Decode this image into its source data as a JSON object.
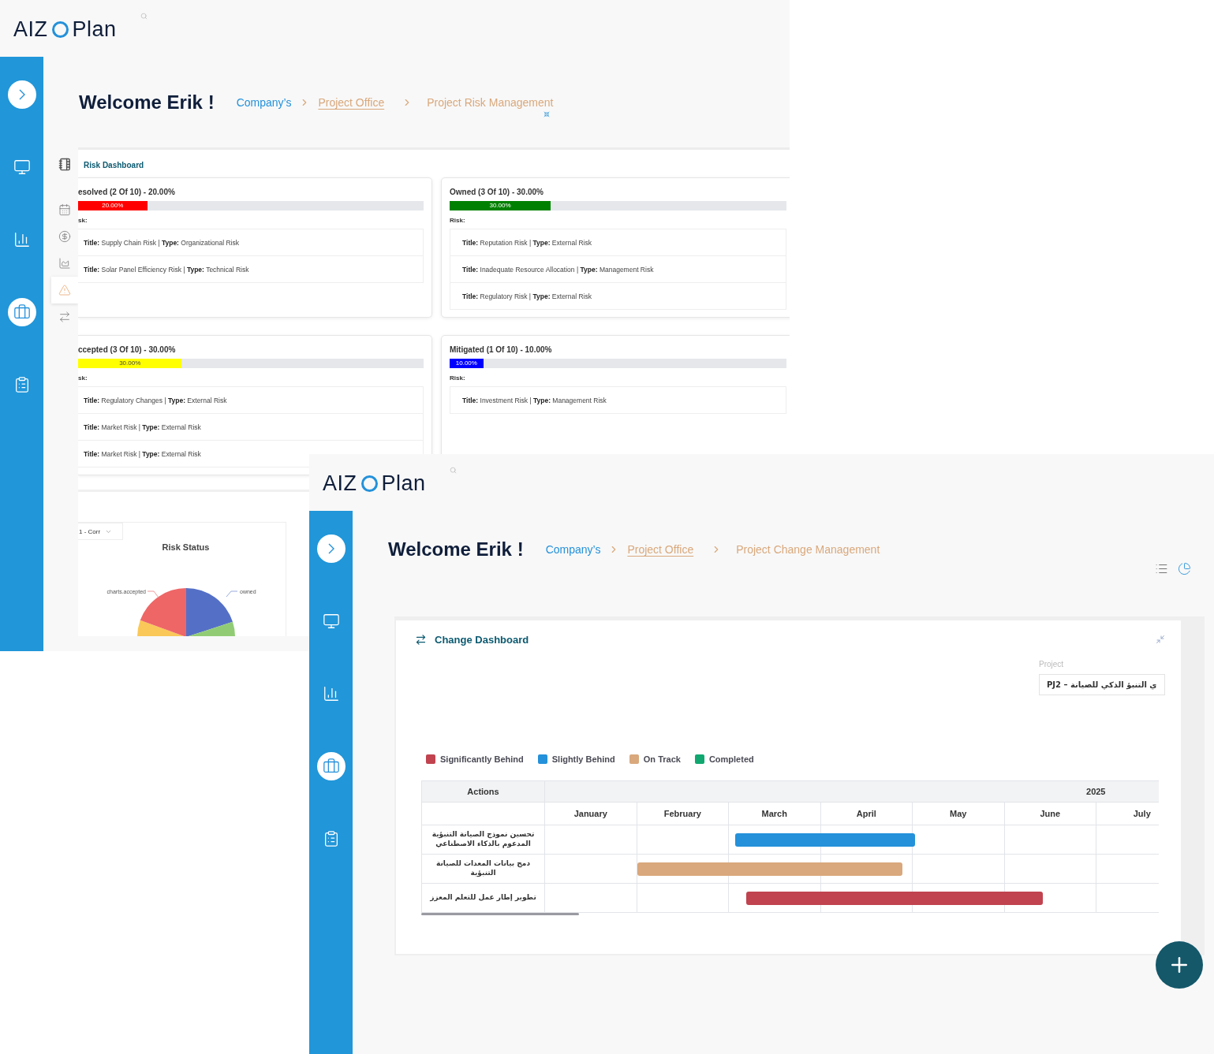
{
  "risk_screen": {
    "logo": {
      "left": "AIZ",
      "right": "Plan"
    },
    "sidebar": [
      {
        "kind": "toggle"
      },
      {
        "kind": "monitor",
        "selected": false
      },
      {
        "kind": "analytics",
        "selected": false
      },
      {
        "kind": "briefcase",
        "selected": true
      },
      {
        "kind": "clipboard",
        "selected": false
      }
    ],
    "welcome": "Welcome Erik !",
    "breadcrumb": [
      {
        "label": "Company’s",
        "kind": "root"
      },
      {
        "label": "Project Office",
        "kind": "link"
      },
      {
        "label": "Project Risk Management",
        "kind": "current"
      }
    ],
    "sub_sidebar": [
      {
        "kind": "calendar",
        "selected": false
      },
      {
        "kind": "finance",
        "selected": false
      },
      {
        "kind": "trend",
        "selected": false
      },
      {
        "kind": "warning",
        "selected": true
      },
      {
        "kind": "swap",
        "selected": false
      }
    ],
    "dashboard_title": "Risk Dashboard",
    "cards": [
      {
        "title": "esolved (2 Of 10) - 20.00%",
        "level": 0.2,
        "bar_label": "20.00%",
        "color": "#ff0000",
        "list_label": "sk:",
        "risks": [
          "**Title:** Supply Chain Risk | **Type:** Organizational Risk",
          "**Title:** Solar Panel Efficiency Risk | **Type:** Technical Risk"
        ]
      },
      {
        "title": "Owned (3 Of 10) - 30.00%",
        "level": 0.3,
        "bar_label": "30.00%",
        "color": "#008000",
        "list_label": "Risk:",
        "risks": [
          "**Title:** Reputation Risk | **Type:** External Risk",
          "**Title:** Inadequate Resource Allocation | **Type:** Management Risk",
          "**Title:** Regulatory Risk | **Type:** External Risk"
        ]
      },
      {
        "title": "ccepted (3 Of 10) - 30.00%",
        "level": 0.3,
        "bar_label": "30.00%",
        "color": "#ffff00",
        "list_label": "sk:",
        "risks": [
          "**Title:** Regulatory Changes | **Type:** External Risk",
          "**Title:** Market Risk | **Type:** External Risk",
          "**Title:** Market Risk | **Type:** External Risk"
        ]
      },
      {
        "title": "Mitigated (1 Of 10) - 10.00%",
        "level": 0.1,
        "bar_label": "10.00%",
        "color": "#0000ff",
        "list_label": "Risk:",
        "risks": [
          "**Title:** Investment Risk | **Type:** Management Risk"
        ]
      }
    ],
    "status_chart": {
      "filter": "1 - Corr",
      "title": "Risk Status",
      "labels": [
        "charts.accepted",
        "owned"
      ]
    }
  },
  "change_screen": {
    "logo": {
      "left": "AIZ",
      "right": "Plan"
    },
    "sidebar": [
      {
        "kind": "toggle"
      },
      {
        "kind": "monitor",
        "selected": false
      },
      {
        "kind": "analytics",
        "selected": false
      },
      {
        "kind": "briefcase",
        "selected": true
      },
      {
        "kind": "clipboard",
        "selected": false
      }
    ],
    "welcome": "Welcome Erik !",
    "breadcrumb": [
      {
        "label": "Company’s",
        "kind": "root"
      },
      {
        "label": "Project Office",
        "kind": "link"
      },
      {
        "label": "Project Change Management",
        "kind": "current"
      }
    ],
    "dashboard_title": "Change Dashboard",
    "project_field": {
      "label": "Project",
      "value": "PJ2 – ي التنبؤ الذكي للصيانة"
    },
    "legend": [
      {
        "label": "Significantly Behind",
        "color": "#c0434f"
      },
      {
        "label": "Slightly Behind",
        "color": "#2491da"
      },
      {
        "label": "On Track",
        "color": "#d9a87c"
      },
      {
        "label": "Completed",
        "color": "#10a870"
      }
    ],
    "gantt": {
      "row_header": "Actions",
      "year": "2025",
      "months": [
        "January",
        "February",
        "March",
        "April",
        "May",
        "June",
        "July"
      ],
      "rows": [
        {
          "action": "تحسين نموذج الصيانة التنبؤية المدعوم بالذكاء الاصطناعي",
          "color": "#2491da"
        },
        {
          "action": "دمج بيانات المعدات للصيانة التنبؤية",
          "color": "#d9a87c"
        },
        {
          "action": "تطوير إطار عمل للتعلم المعزز",
          "color": "#c0434f"
        }
      ]
    }
  }
}
